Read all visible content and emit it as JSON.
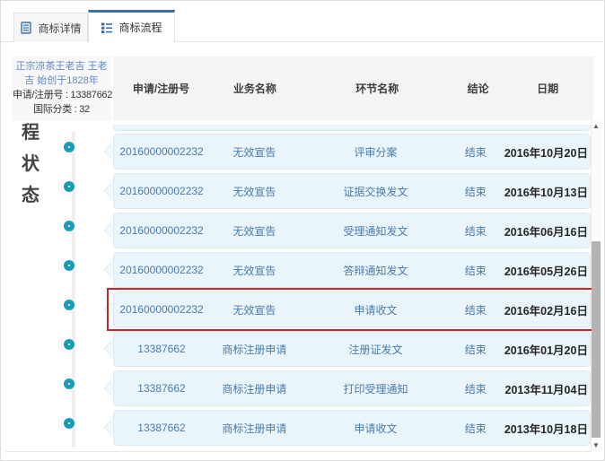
{
  "tabs": [
    {
      "label": "商标详情",
      "icon": "document-icon",
      "active": false
    },
    {
      "label": "商标流程",
      "icon": "list-icon",
      "active": true
    }
  ],
  "sidebar": {
    "info": {
      "title": "正宗凉茶王老吉 王老吉 始创于1828年",
      "registration": "申请/注册号 : 13387662",
      "classification": "国际分类 : 32"
    },
    "vertical_label": "程状态"
  },
  "table": {
    "headers": [
      "申请/注册号",
      "业务名称",
      "环节名称",
      "结论",
      "日期"
    ],
    "rows": [
      {
        "reg_no": "20160000002232",
        "business": "无效宣告",
        "step": "评审分案",
        "conclusion": "结束",
        "date": "2016年10月20日",
        "highlighted": false
      },
      {
        "reg_no": "20160000002232",
        "business": "无效宣告",
        "step": "证据交换发文",
        "conclusion": "结束",
        "date": "2016年10月13日",
        "highlighted": false
      },
      {
        "reg_no": "20160000002232",
        "business": "无效宣告",
        "step": "受理通知发文",
        "conclusion": "结束",
        "date": "2016年06月16日",
        "highlighted": false
      },
      {
        "reg_no": "20160000002232",
        "business": "无效宣告",
        "step": "答辩通知发文",
        "conclusion": "结束",
        "date": "2016年05月26日",
        "highlighted": false
      },
      {
        "reg_no": "20160000002232",
        "business": "无效宣告",
        "step": "申请收文",
        "conclusion": "结束",
        "date": "2016年02月16日",
        "highlighted": true
      },
      {
        "reg_no": "13387662",
        "business": "商标注册申请",
        "step": "注册证发文",
        "conclusion": "结束",
        "date": "2016年01月20日",
        "highlighted": false
      },
      {
        "reg_no": "13387662",
        "business": "商标注册申请",
        "step": "打印受理通知",
        "conclusion": "结束",
        "date": "2013年11月04日",
        "highlighted": false
      },
      {
        "reg_no": "13387662",
        "business": "商标注册申请",
        "step": "申请收文",
        "conclusion": "结束",
        "date": "2013年10月18日",
        "highlighted": false
      }
    ]
  },
  "scrollbar": {
    "up_icon": "▲",
    "down_icon": "▼"
  },
  "colors": {
    "accent": "#3f6fa5",
    "timeline_circle": "#1a9cb9",
    "highlight_border": "#cc2526",
    "row_text": "#4a7cae",
    "row_background": "#e9f4fb",
    "date_text": "#262626"
  }
}
